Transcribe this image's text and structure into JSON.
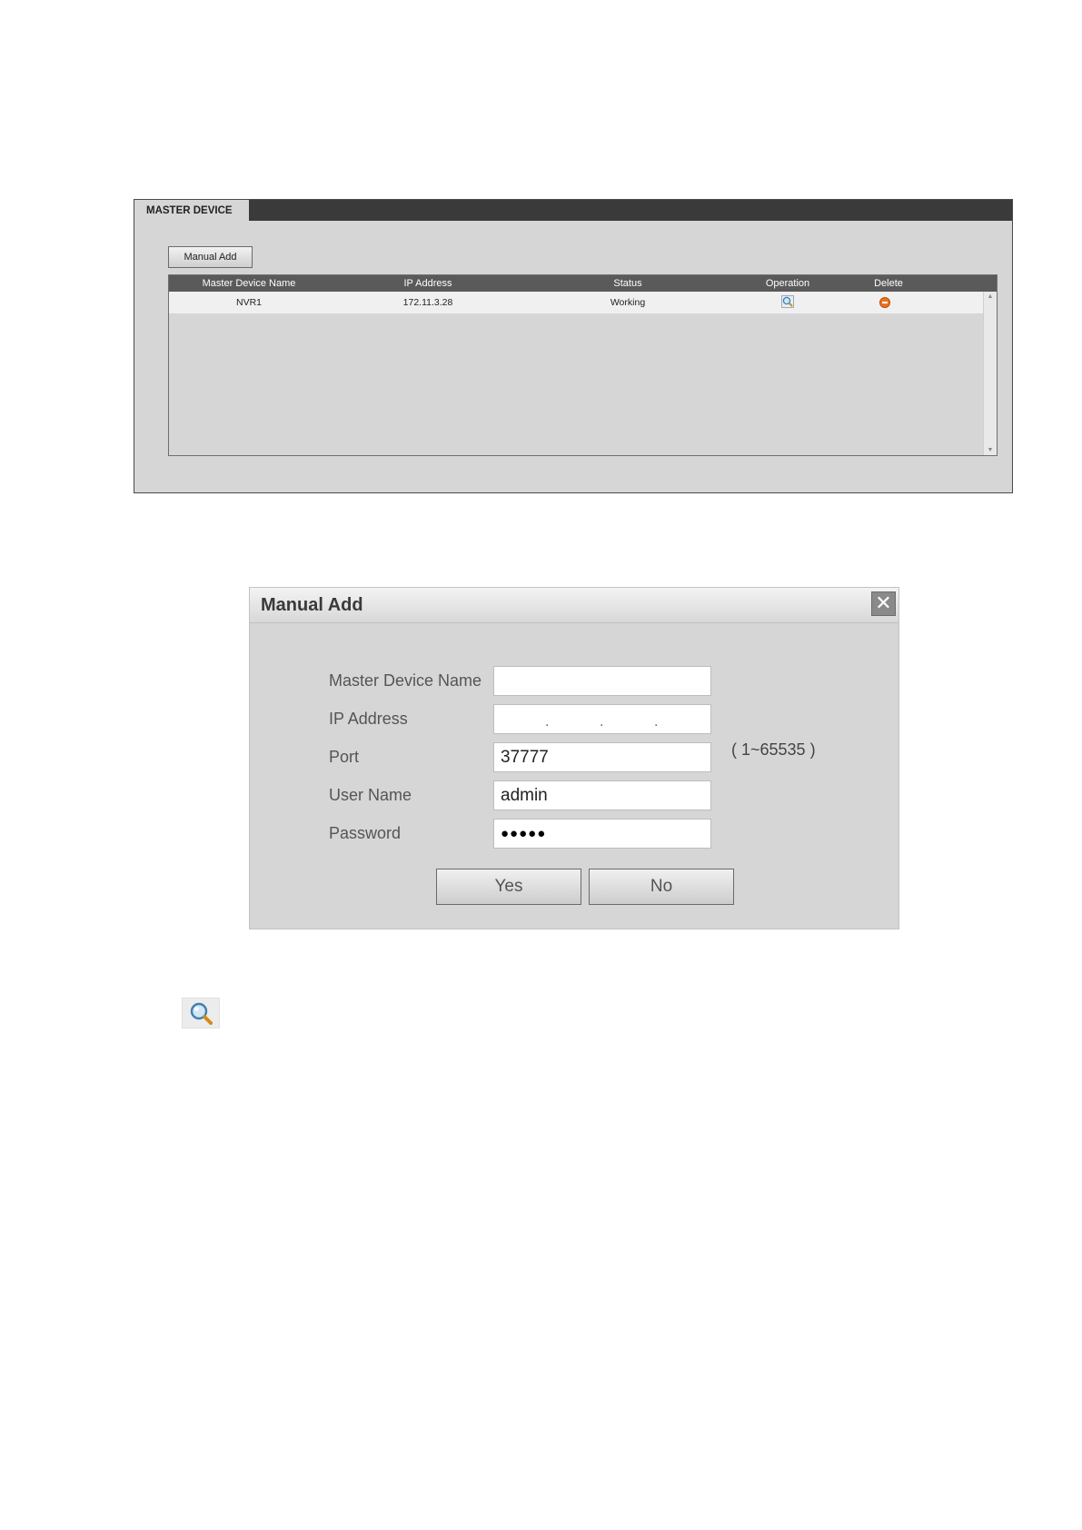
{
  "master_device": {
    "tab_label": "MASTER DEVICE",
    "manual_add_label": "Manual Add",
    "columns": [
      "Master Device Name",
      "IP Address",
      "Status",
      "Operation",
      "Delete"
    ],
    "rows": [
      {
        "name": "NVR1",
        "ip": "172.11.3.28",
        "status": "Working",
        "operation_icon": "search-icon",
        "delete_icon": "delete-icon"
      }
    ]
  },
  "manual_add_dialog": {
    "title": "Manual Add",
    "close_icon": "close-icon",
    "fields": {
      "device_name": {
        "label": "Master Device Name",
        "value": ""
      },
      "ip_address": {
        "label": "IP Address",
        "value": ". . ."
      },
      "port": {
        "label": "Port",
        "value": "37777",
        "range": "( 1~65535 )"
      },
      "user_name": {
        "label": "User Name",
        "value": "admin"
      },
      "password": {
        "label": "Password",
        "value": "●●●●●"
      }
    },
    "yes_label": "Yes",
    "no_label": "No"
  },
  "standalone_icon": "search-icon",
  "colors": {
    "panel_bg": "#d6d6d6",
    "header_bar": "#3a3a3a",
    "table_header": "#5a5a5a",
    "delete_orange": "#e8731c"
  }
}
